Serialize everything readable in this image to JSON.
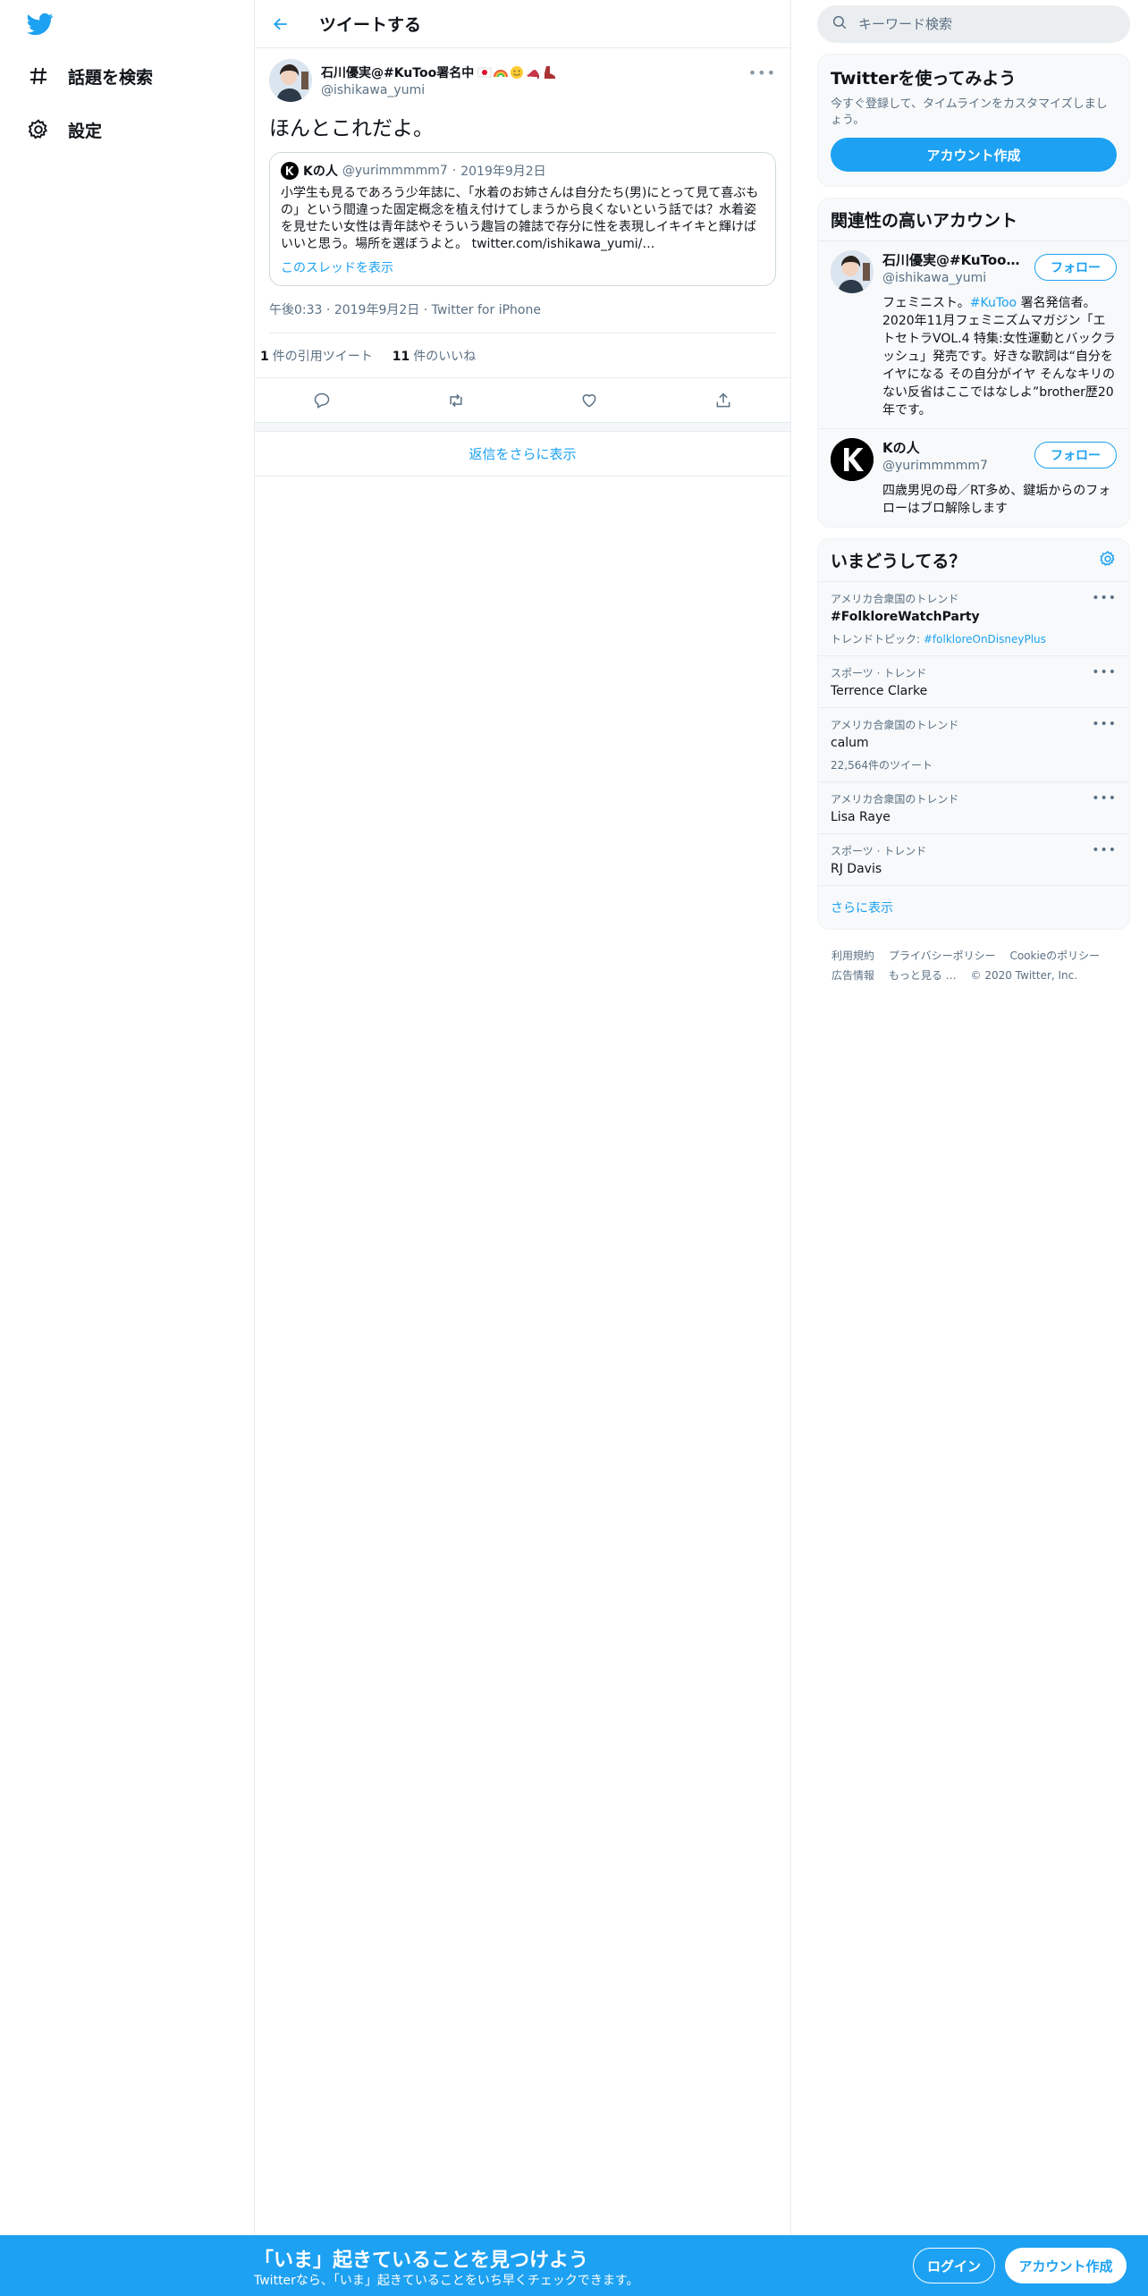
{
  "nav": {
    "logo_icon": "twitter-bird-icon",
    "items": [
      {
        "label": "話題を検索",
        "icon": "hashtag-icon"
      },
      {
        "label": "設定",
        "icon": "gear-icon"
      }
    ]
  },
  "header": {
    "title": "ツイートする"
  },
  "tweet": {
    "author_name": "石川優実@#KuToo署名中",
    "author_handle": "@ishikawa_yumi",
    "text": "ほんとこれだよ。",
    "quote": {
      "name": "Kの人",
      "handle": "@yurimmmmm7",
      "date": "2019年9月2日",
      "body": "小学生も見るであろう少年誌に、「水着のお姉さんは自分たち(男)にとって見て喜ぶもの」という間違った固定概念を植え付けてしまうから良くないという話では？水着姿を見せたい女性は青年誌やそういう趣旨の雑誌で存分に性を表現しイキイキと輝けばいいと思う。場所を選ぼうよと。 twitter.com/ishikawa_yumi/…",
      "thread_link": "このスレッドを表示"
    },
    "time": "午後0:33",
    "date": "2019年9月2日",
    "source": "Twitter for iPhone",
    "stats": {
      "quote_count": "1",
      "quote_label": "件の引用ツイート",
      "like_count": "11",
      "like_label": "件のいいね"
    },
    "more_replies": "返信をさらに表示"
  },
  "search": {
    "placeholder": "キーワード検索"
  },
  "signup_card": {
    "title": "Twitterを使ってみよう",
    "subtitle": "今すぐ登録して、タイムラインをカスタマイズしましょう。",
    "button": "アカウント作成"
  },
  "related": {
    "title": "関連性の高いアカウント",
    "accounts": [
      {
        "name": "石川優実@#KuToo署...",
        "handle": "@ishikawa_yumi",
        "bio_pre": "フェミニスト。",
        "bio_tag": "#KuToo",
        "bio_post": " 署名発信者。2020年11月フェミニズムマガジン「エトセトラVOL.4 特集:女性運動とバックラッシュ」発売です。好きな歌詞は“自分をイヤになる その自分がイヤ そんなキリのない反省はここではなしよ”brother歴20年です。",
        "follow": "フォロー"
      },
      {
        "name": "Kの人",
        "handle": "@yurimmmmm7",
        "bio_pre": "四歳男児の母／RT多め、鍵垢からのフォローはブロ解除します",
        "bio_tag": "",
        "bio_post": "",
        "follow": "フォロー"
      }
    ]
  },
  "trends": {
    "title": "いまどうしてる？",
    "items": [
      {
        "context": "アメリカ合衆国のトレンド",
        "name": "#FolkloreWatchParty",
        "extra_label": "トレンドトピック: ",
        "extra_tag": "#folkloreOnDisneyPlus"
      },
      {
        "context": "スポーツ · トレンド",
        "name": "Terrence Clarke",
        "extra_label": "",
        "extra_tag": ""
      },
      {
        "context": "アメリカ合衆国のトレンド",
        "name": "calum",
        "extra_label": "22,564件のツイート",
        "extra_tag": ""
      },
      {
        "context": "アメリカ合衆国のトレンド",
        "name": "Lisa Raye",
        "extra_label": "",
        "extra_tag": ""
      },
      {
        "context": "スポーツ · トレンド",
        "name": "RJ Davis",
        "extra_label": "",
        "extra_tag": ""
      }
    ],
    "show_more": "さらに表示"
  },
  "footer": {
    "links": [
      "利用規約",
      "プライバシーポリシー",
      "Cookieのポリシー",
      "広告情報",
      "もっと見る …",
      "© 2020 Twitter, Inc."
    ]
  },
  "banner": {
    "title": "「いま」起きていることを見つけよう",
    "subtitle": "Twitterなら、「いま」起きていることをいち早くチェックできます。",
    "login": "ログイン",
    "signup": "アカウント作成"
  },
  "colors": {
    "accent": "#1da1f2",
    "text": "#0f1419",
    "muted": "#5b7083"
  }
}
